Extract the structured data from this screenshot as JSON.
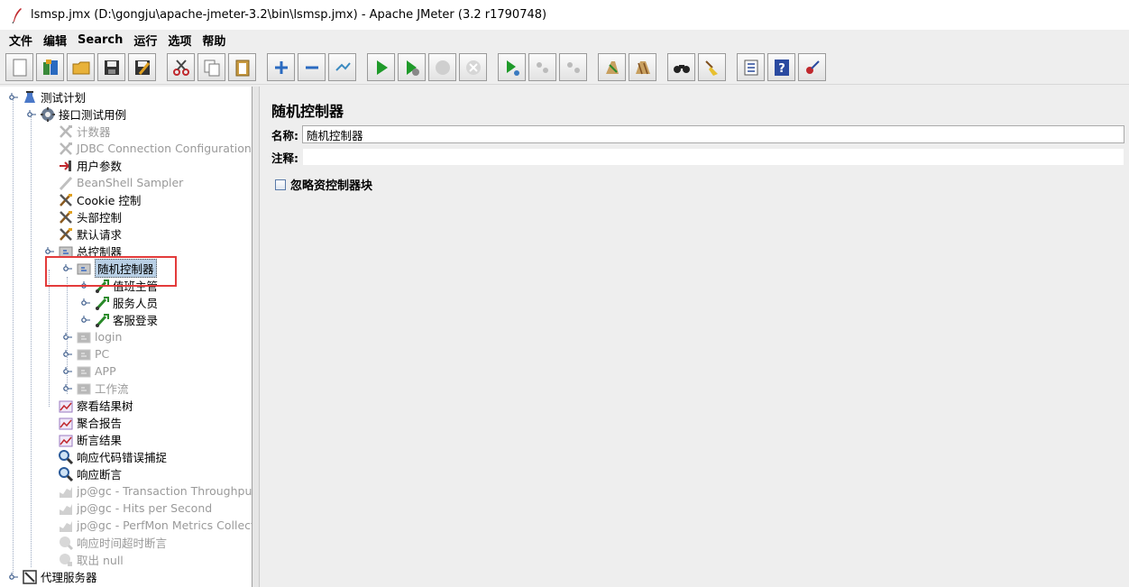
{
  "window": {
    "title": "lsmsp.jmx (D:\\gongju\\apache-jmeter-3.2\\bin\\lsmsp.jmx) - Apache JMeter (3.2 r1790748)"
  },
  "menu": [
    "文件",
    "编辑",
    "Search",
    "运行",
    "选项",
    "帮助"
  ],
  "toolbar": {
    "buttons": [
      "new-icon",
      "templates-icon",
      "open-icon",
      "save-icon",
      "save-as-icon",
      "cut-icon",
      "copy-icon",
      "paste-icon",
      "expand-icon",
      "collapse-icon",
      "toggle-icon",
      "start-icon",
      "start-no-pause-icon",
      "stop-icon",
      "shutdown-icon",
      "remote-start-icon",
      "remote-stop-icon",
      "remote-shutdown-icon",
      "clear-icon",
      "clear-all-icon",
      "search-icon",
      "reset-search-icon",
      "function-helper-icon",
      "help-icon",
      "log-viewer-icon"
    ]
  },
  "tree": {
    "nodes": [
      {
        "label": "测试计划",
        "icon": "test-plan-icon",
        "disabled": false
      },
      {
        "label": "接口测试用例",
        "icon": "thread-group-icon",
        "disabled": false
      },
      {
        "label": "计数器",
        "icon": "config-icon",
        "disabled": true
      },
      {
        "label": "JDBC Connection Configuration",
        "icon": "config-icon",
        "disabled": true
      },
      {
        "label": "用户参数",
        "icon": "preprocessor-icon",
        "disabled": false
      },
      {
        "label": "BeanShell Sampler",
        "icon": "sampler-icon",
        "disabled": true
      },
      {
        "label": "Cookie 控制",
        "icon": "config-icon",
        "disabled": false
      },
      {
        "label": "头部控制",
        "icon": "config-icon",
        "disabled": false
      },
      {
        "label": "默认请求",
        "icon": "config-icon",
        "disabled": false
      },
      {
        "label": "总控制器",
        "icon": "controller-icon",
        "disabled": false
      },
      {
        "label": "随机控制器",
        "icon": "controller-icon",
        "disabled": false
      },
      {
        "label": "值班主管",
        "icon": "sampler-icon",
        "disabled": false
      },
      {
        "label": "服务人员",
        "icon": "sampler-icon",
        "disabled": false
      },
      {
        "label": "客服登录",
        "icon": "sampler-icon",
        "disabled": false
      },
      {
        "label": "login",
        "icon": "controller-icon",
        "disabled": true
      },
      {
        "label": "PC",
        "icon": "controller-icon",
        "disabled": true
      },
      {
        "label": "APP",
        "icon": "controller-icon",
        "disabled": true
      },
      {
        "label": "工作流",
        "icon": "controller-icon",
        "disabled": true
      },
      {
        "label": "察看结果树",
        "icon": "listener-icon",
        "disabled": false
      },
      {
        "label": "聚合报告",
        "icon": "listener-icon",
        "disabled": false
      },
      {
        "label": "断言结果",
        "icon": "listener-icon",
        "disabled": false
      },
      {
        "label": "响应代码错误捕捉",
        "icon": "assertion-icon",
        "disabled": false
      },
      {
        "label": "响应断言",
        "icon": "assertion-icon",
        "disabled": false
      },
      {
        "label": "jp@gc - Transaction Throughput vs",
        "icon": "graph-icon",
        "disabled": true
      },
      {
        "label": "jp@gc - Hits per Second",
        "icon": "graph-icon",
        "disabled": true
      },
      {
        "label": "jp@gc - PerfMon Metrics Collector",
        "icon": "graph-icon",
        "disabled": true
      },
      {
        "label": "响应时间超时断言",
        "icon": "assertion-icon",
        "disabled": true
      },
      {
        "label": "取出 null",
        "icon": "postprocessor-icon",
        "disabled": true
      },
      {
        "label": "代理服务器",
        "icon": "workbench-icon",
        "disabled": false
      }
    ]
  },
  "panel": {
    "title": "随机控制器",
    "name_label": "名称:",
    "name_value": "随机控制器",
    "comment_label": "注释:",
    "comment_value": "",
    "ignore_label": "忽略资控制器块"
  },
  "colors": {
    "selection": "#b8cfe5",
    "highlight_box": "#e33b3b",
    "disabled_text": "#9a9a9a"
  }
}
